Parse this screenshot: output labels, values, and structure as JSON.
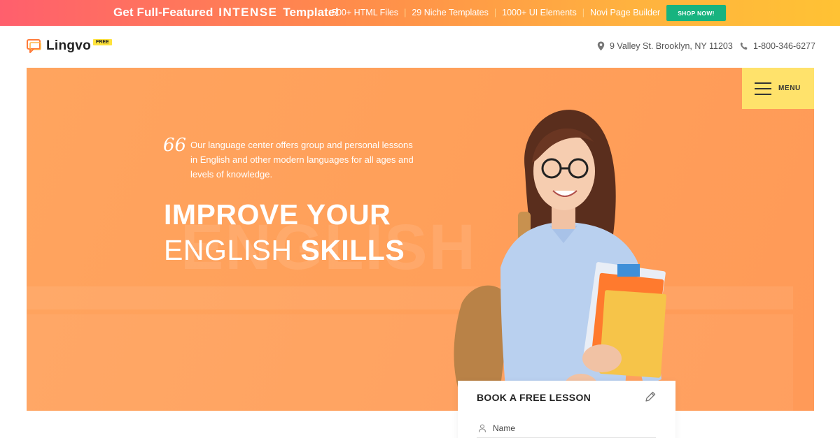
{
  "promo": {
    "title_pre": "Get Full-Featured",
    "title_brand": "INTENSE",
    "title_post": "Template!",
    "features": [
      "500+ HTML Files",
      "29 Niche Templates",
      "1000+ UI Elements",
      "Novi Page Builder"
    ],
    "separator": "|",
    "cta_label": "SHOP NOW!"
  },
  "header": {
    "logo_text": "Lingvo",
    "logo_badge": "FREE",
    "address": "9 Valley St. Brooklyn, NY 11203",
    "phone": "1-800-346-6277"
  },
  "hero": {
    "menu_label": "MENU",
    "quote_mark": "66",
    "intro": "Our language center offers group and personal lessons in English and other modern languages for all ages and levels of knowledge.",
    "title_line1": "IMPROVE YOUR",
    "title_line2_light": "ENGLISH",
    "title_line2_bold": "SKILLS",
    "background_word": "ENGLISH"
  },
  "booking": {
    "title": "BOOK A FREE LESSON",
    "name_label": "Name"
  },
  "colors": {
    "accent_orange": "#ffa45f",
    "menu_yellow": "#ffe26b",
    "cta_green": "#17b37f"
  },
  "icons": {
    "logo": "chat-bubble-icon",
    "address": "map-pin-icon",
    "phone": "phone-icon",
    "menu": "hamburger-icon",
    "edit": "pencil-icon",
    "name": "user-icon"
  }
}
